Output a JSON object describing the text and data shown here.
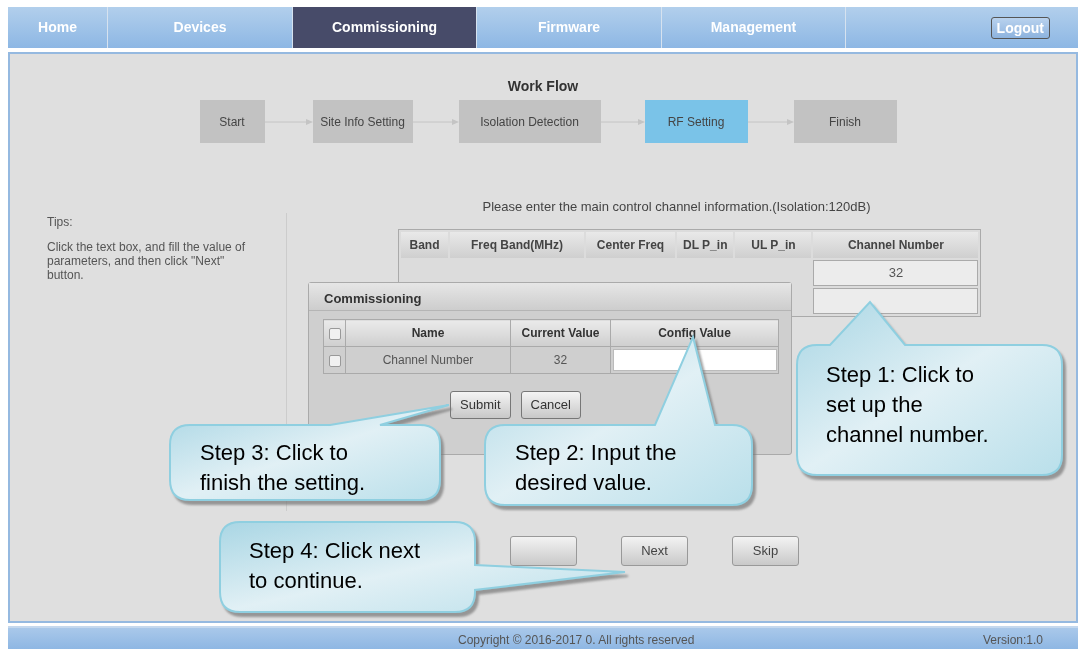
{
  "nav_tabs": [
    {
      "label": "Home",
      "selected": false
    },
    {
      "label": "Devices",
      "selected": false
    },
    {
      "label": "Commissioning",
      "selected": true
    },
    {
      "label": "Firmware",
      "selected": false
    },
    {
      "label": "Management",
      "selected": false
    }
  ],
  "logout_button": "Logout",
  "workflow": {
    "title": "Work Flow",
    "steps": [
      {
        "label": "Start",
        "selected": false
      },
      {
        "label": "Site Info Setting",
        "selected": false
      },
      {
        "label": "Isolation Detection",
        "selected": false
      },
      {
        "label": "RF Setting",
        "selected": true
      },
      {
        "label": "Finish",
        "selected": false
      }
    ]
  },
  "tips": {
    "title": "Tips:",
    "text": "Click the text box, and fill the value of parameters, and then click \"Next\" button."
  },
  "message": "Please enter the main control channel information.(Isolation:120dB)",
  "channel_table": {
    "columns": [
      "Band",
      "Freq Band(MHz)",
      "Center Freq",
      "DL P_in",
      "UL P_in",
      "Channel Number"
    ],
    "rows": [
      {
        "channel_number": "32"
      },
      {
        "channel_number": null
      }
    ]
  },
  "dialog": {
    "title": "Commissioning",
    "select_all_checked": false,
    "columns": [
      "Name",
      "Current Value",
      "Config Value"
    ],
    "rows": [
      {
        "checked": false,
        "name": "Channel Number",
        "current_value": "32"
      }
    ],
    "buttons": [
      "Submit",
      "Cancel"
    ]
  },
  "bottom_buttons": [
    {
      "kind": "covered"
    },
    {
      "kind": "labeled",
      "label": "Next"
    },
    {
      "kind": "labeled",
      "label": "Skip"
    }
  ],
  "footer": {
    "copyright": "Copyright © 2016-2017 0. All rights reserved",
    "version": "Version:1.0"
  },
  "callouts": [
    "Step 1: Click to set up the channel number.",
    "Step 3: Click to finish the setting.",
    "Step 2: Input the desired value.",
    "Step 4: Click next to continue."
  ]
}
